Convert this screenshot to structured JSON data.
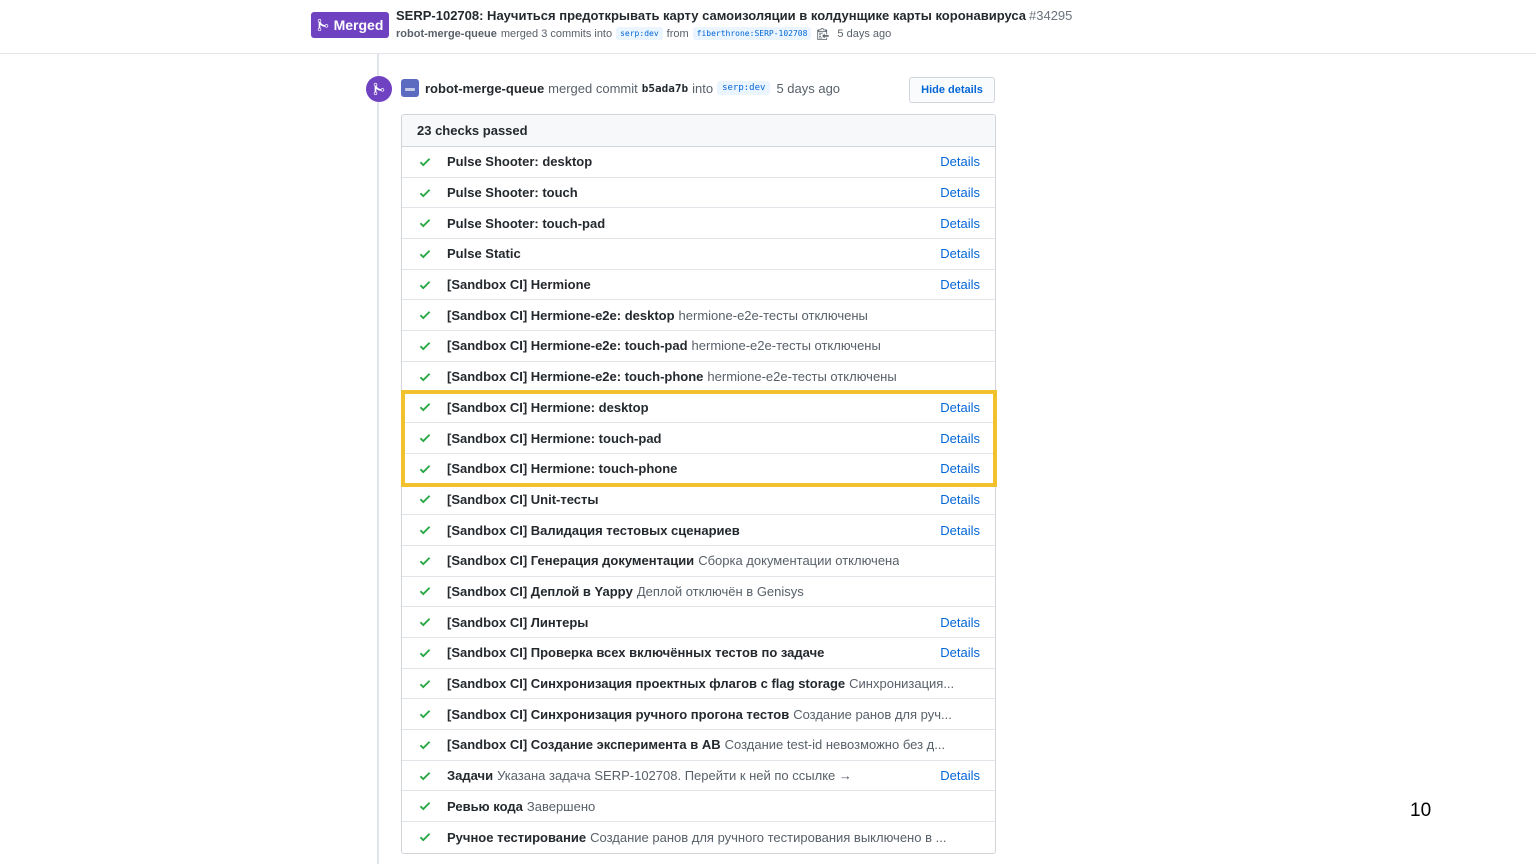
{
  "pr": {
    "status_label": "Merged",
    "title": "SERP-102708: Научиться предоткрывать карту самоизоляции в колдунщике карты коронавируса",
    "number": "#34295",
    "author": "robot-merge-queue",
    "merged_text": "merged 3 commits into",
    "base_branch": "serp:dev",
    "from_text": "from",
    "head_branch": "fiberthrone:SERP-102708",
    "time": "5 days ago"
  },
  "event": {
    "author": "robot-merge-queue",
    "action": "merged commit",
    "sha": "b5ada7b",
    "into_text": "into",
    "branch": "serp:dev",
    "time": "5 days ago",
    "hide_details_label": "Hide details"
  },
  "checks": {
    "summary": "23 checks passed",
    "details_label": "Details",
    "items": [
      {
        "name": "Pulse Shooter: desktop",
        "desc": "",
        "details": true
      },
      {
        "name": "Pulse Shooter: touch",
        "desc": "",
        "details": true
      },
      {
        "name": "Pulse Shooter: touch-pad",
        "desc": "",
        "details": true
      },
      {
        "name": "Pulse Static",
        "desc": "",
        "details": true
      },
      {
        "name": "[Sandbox CI] Hermione",
        "desc": "",
        "details": true
      },
      {
        "name": "[Sandbox CI] Hermione-e2e: desktop",
        "desc": "hermione-e2e-тесты отключены",
        "details": false
      },
      {
        "name": "[Sandbox CI] Hermione-e2e: touch-pad",
        "desc": "hermione-e2e-тесты отключены",
        "details": false
      },
      {
        "name": "[Sandbox CI] Hermione-e2e: touch-phone",
        "desc": "hermione-e2e-тесты отключены",
        "details": false
      },
      {
        "name": "[Sandbox CI] Hermione: desktop",
        "desc": "",
        "details": true
      },
      {
        "name": "[Sandbox CI] Hermione: touch-pad",
        "desc": "",
        "details": true
      },
      {
        "name": "[Sandbox CI] Hermione: touch-phone",
        "desc": "",
        "details": true
      },
      {
        "name": "[Sandbox CI] Unit-тесты",
        "desc": "",
        "details": true
      },
      {
        "name": "[Sandbox CI] Валидация тестовых сценариев",
        "desc": "",
        "details": true
      },
      {
        "name": "[Sandbox CI] Генерация документации",
        "desc": "Сборка документации отключена",
        "details": false
      },
      {
        "name": "[Sandbox CI] Деплой в Yappy",
        "desc": "Деплой отключён в Genisys",
        "details": false
      },
      {
        "name": "[Sandbox CI] Линтеры",
        "desc": "",
        "details": true
      },
      {
        "name": "[Sandbox CI] Проверка всех включённых тестов по задаче",
        "desc": "",
        "details": true
      },
      {
        "name": "[Sandbox CI] Синхронизация проектных флагов с flag storage",
        "desc": "Синхронизация...",
        "details": false
      },
      {
        "name": "[Sandbox CI] Синхронизация ручного прогона тестов",
        "desc": "Создание ранов для руч...",
        "details": false
      },
      {
        "name": "[Sandbox CI] Создание эксперимента в AB",
        "desc": "Создание test-id невозможно без д...",
        "details": false
      },
      {
        "name": "Задачи",
        "desc": "Указана задача SERP-102708. Перейти к ней по ссылке →",
        "details": true
      },
      {
        "name": "Ревью кода",
        "desc": "Завершено",
        "details": false
      },
      {
        "name": "Ручное тестирование",
        "desc": "Создание ранов для ручного тестирования выключено в ...",
        "details": false
      }
    ]
  },
  "page_number": "10",
  "colors": {
    "merged_purple": "#6f42c1",
    "link_blue": "#0366d6",
    "check_green": "#28a745",
    "highlight_yellow": "#f2c12e"
  },
  "icons": {
    "merge": "git-merge-icon",
    "check": "check-icon",
    "copy": "clipboard-icon"
  }
}
